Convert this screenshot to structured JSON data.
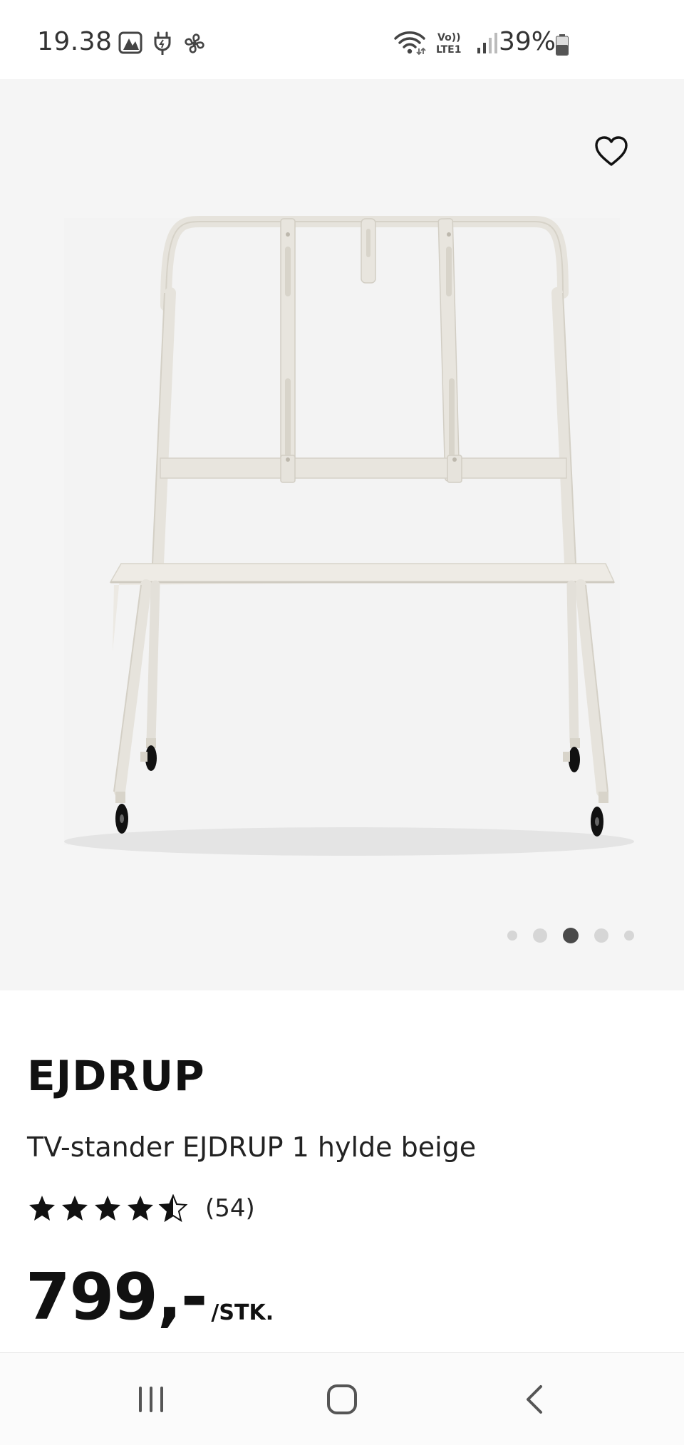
{
  "status_bar": {
    "time": "19.38",
    "battery": "39%",
    "icons_left": [
      "gallery-icon",
      "charging-icon",
      "fan-icon"
    ],
    "icons_right": [
      "wifi-icon",
      "volte-icon",
      "signal-icon",
      "battery-icon"
    ],
    "volte_text": "Vo)) LTE1"
  },
  "product": {
    "image_alt": "TV-stander EJDRUP",
    "favorite_icon": "heart-icon",
    "carousel": {
      "count": 5,
      "active_index": 2
    },
    "brand": "EJDRUP",
    "description": "TV-stander EJDRUP 1 hylde beige",
    "rating": {
      "value": 4.5,
      "max": 5,
      "count_text": "(54)"
    },
    "price": {
      "amount": "799,-",
      "unit": "/STK."
    }
  },
  "nav_bar": {
    "items": [
      "recent-apps-icon",
      "home-icon",
      "back-icon"
    ]
  },
  "colors": {
    "image_bg": "#f5f5f5",
    "stand": "#e9e6df",
    "stand_shade": "#d8d4cb",
    "dot_active": "#4a4a4a",
    "dot_inactive": "#d6d6d6"
  }
}
